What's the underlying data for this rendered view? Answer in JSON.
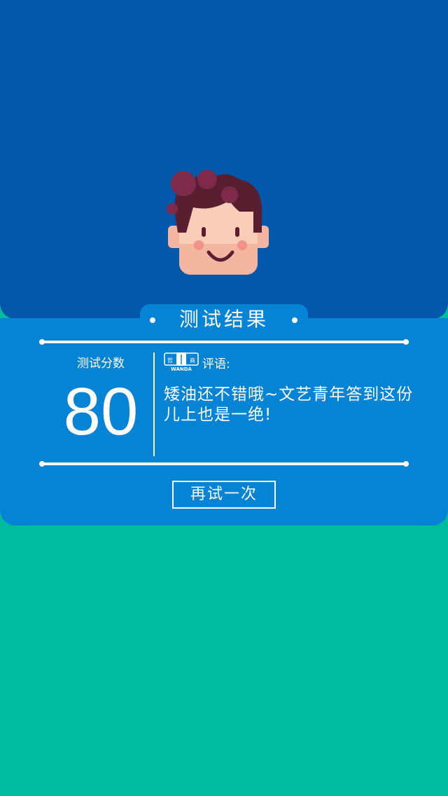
{
  "result": {
    "title": "测试结果",
    "score_label": "测试分数",
    "score": "80",
    "logo_top_text": "哲理商",
    "logo_brand": "WANDA",
    "comment_label": "评语:",
    "comment": "矮油还不错哦~文艺青年答到这份儿上也是一绝!",
    "retry_label": "再试一次"
  },
  "colors": {
    "top_panel": "#0158AA",
    "card": "#0584D6",
    "background": "#00BB9D"
  }
}
